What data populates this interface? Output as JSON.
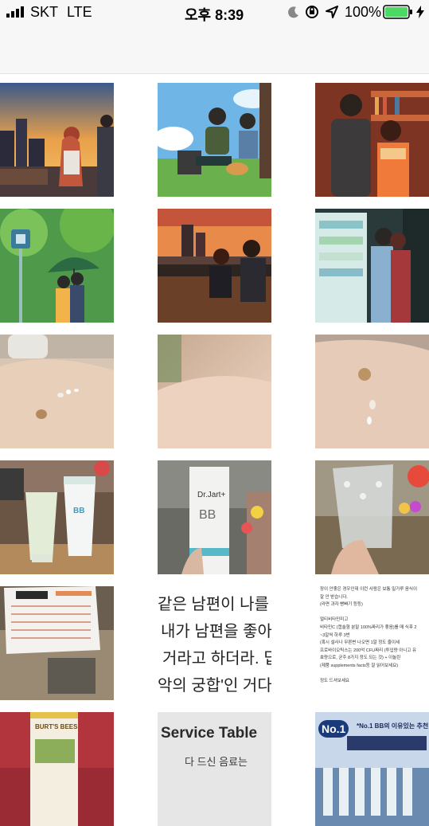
{
  "status_bar": {
    "carrier": "SKT",
    "network": "LTE",
    "time": "오후 8:39",
    "battery_percent": "100%",
    "battery_level": 1.0
  },
  "photos": [
    {
      "id": "p1",
      "desc": "illustration-city-sunset-couple"
    },
    {
      "id": "p2",
      "desc": "illustration-park-couple-dog"
    },
    {
      "id": "p3",
      "desc": "illustration-bookshelf-couple"
    },
    {
      "id": "p4",
      "desc": "illustration-umbrella-couple"
    },
    {
      "id": "p5",
      "desc": "illustration-train-couple"
    },
    {
      "id": "p6",
      "desc": "illustration-vending-machine-kiss"
    },
    {
      "id": "p7",
      "desc": "photo-hand-cream-swatch"
    },
    {
      "id": "p8",
      "desc": "photo-blurred-skin"
    },
    {
      "id": "p9",
      "desc": "photo-hand-swatch-2"
    },
    {
      "id": "p10",
      "desc": "photo-bb-cream-tubes"
    },
    {
      "id": "p11",
      "desc": "photo-drjart-bb-box"
    },
    {
      "id": "p12",
      "desc": "photo-bubble-wrap-tube"
    },
    {
      "id": "p13",
      "desc": "photo-parcel-label"
    },
    {
      "id": "p14",
      "desc": "photo-korean-text"
    },
    {
      "id": "p15",
      "desc": "photo-product-text"
    },
    {
      "id": "p16",
      "desc": "photo-burts-bees"
    },
    {
      "id": "p17",
      "desc": "photo-service-table"
    },
    {
      "id": "p18",
      "desc": "photo-no1-bb-ad"
    }
  ],
  "photo_text": {
    "drjart_brand": "Dr.Jart+",
    "drjart_bb": "BB",
    "bb_tube": "BB",
    "korean_lines": [
      "같은 남편이 나를",
      "내가 남편을 좋아",
      "거라고 하더라. 딥",
      "악의 궁합'인 거다"
    ],
    "product_lines": [
      "장이 안좋은 경우인데 이런 사람은 보통 밀가루 음식이",
      "잘 안 받습니다.",
      "(라면 과자 빵빠기 등등)",
      "",
      "멀티비타민미고",
      "비타민C (캡슐형 분말 100%짜리가 좋음)를 매 식후 2",
      "~3알씩 하루 3번",
      "(혹시 설사나 무른변 나오면 1알 정도 줄이세",
      "프로바이오틱스는 200억 CFU짜리 (투입량 아니고 유",
      "효량으로, 균주 8가지 정도 되는 것) + 이눌린",
      "(제품 supplements facts등 잘 읽어보세요)",
      "",
      "정도 드셔보세요"
    ],
    "burts_bees": "BURT'S BEES",
    "service_title": "Service Table",
    "service_sub": "다 드신 음료는",
    "no1_badge": "No.1",
    "no1_headline": "*No.1 BB의 이유있는 추천"
  }
}
